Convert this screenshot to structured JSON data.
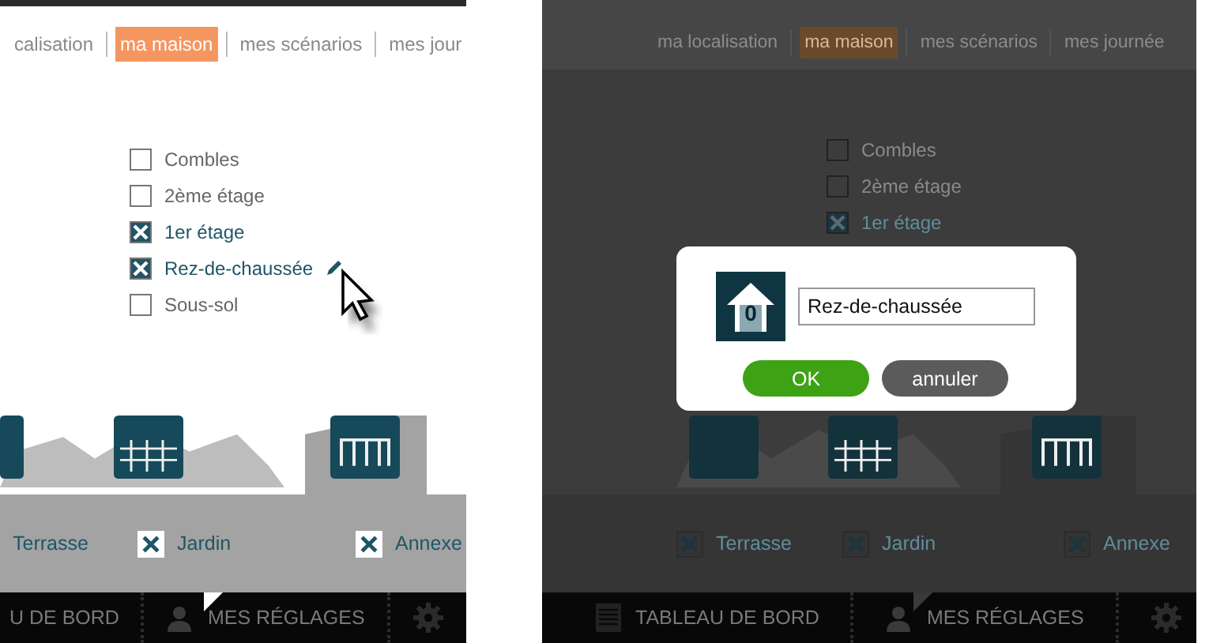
{
  "screens": [
    {
      "dimmed": false,
      "cursor": true,
      "tabs": [
        {
          "label": "calisation",
          "selected": false
        },
        {
          "label": "ma maison",
          "selected": true
        },
        {
          "label": "mes scénarios",
          "selected": false
        },
        {
          "label": "mes jour",
          "selected": false
        }
      ],
      "floors": [
        {
          "label": "Combles",
          "checked": false,
          "edit": false
        },
        {
          "label": "2ème étage",
          "checked": false,
          "edit": false
        },
        {
          "label": "1er étage",
          "checked": true,
          "edit": false
        },
        {
          "label": "Rez-de-chaussée",
          "checked": true,
          "edit": true
        },
        {
          "label": "Sous-sol",
          "checked": false,
          "edit": false
        }
      ],
      "outdoor": [
        {
          "label": "Terrasse"
        },
        {
          "label": "Jardin",
          "checked": true
        },
        {
          "label": "Annexe",
          "checked": true
        }
      ],
      "nav": [
        {
          "label": "U DE BORD",
          "kind": "plain",
          "selected": false
        },
        {
          "label": "MES RÉGLAGES",
          "kind": "user",
          "selected": true
        },
        {
          "kind": "gear",
          "selected": false
        }
      ]
    },
    {
      "dimmed": true,
      "cursor": false,
      "tabs": [
        {
          "label": "ma localisation",
          "selected": false
        },
        {
          "label": "ma maison",
          "selected": true
        },
        {
          "label": "mes scénarios",
          "selected": false
        },
        {
          "label": "mes journée",
          "selected": false
        }
      ],
      "floors": [
        {
          "label": "Combles",
          "checked": false,
          "edit": false
        },
        {
          "label": "2ème étage",
          "checked": false,
          "edit": false
        },
        {
          "label": "1er étage",
          "checked": true,
          "edit": false
        }
      ],
      "outdoor": [
        {
          "label": "Terrasse",
          "checked": true
        },
        {
          "label": "Jardin",
          "checked": true
        },
        {
          "label": "Annexe",
          "checked": true
        }
      ],
      "nav": [
        {
          "label": "TABLEAU DE BORD",
          "kind": "list",
          "selected": false
        },
        {
          "label": "MES RÉGLAGES",
          "kind": "user",
          "selected": true
        },
        {
          "kind": "gear",
          "selected": false
        }
      ],
      "dialog": {
        "icon_label": "0",
        "value": "Rez-de-chaussée",
        "buttons": [
          {
            "label": "OK",
            "kind": "confirm"
          },
          {
            "label": "annuler",
            "kind": "cancel"
          }
        ]
      }
    }
  ]
}
